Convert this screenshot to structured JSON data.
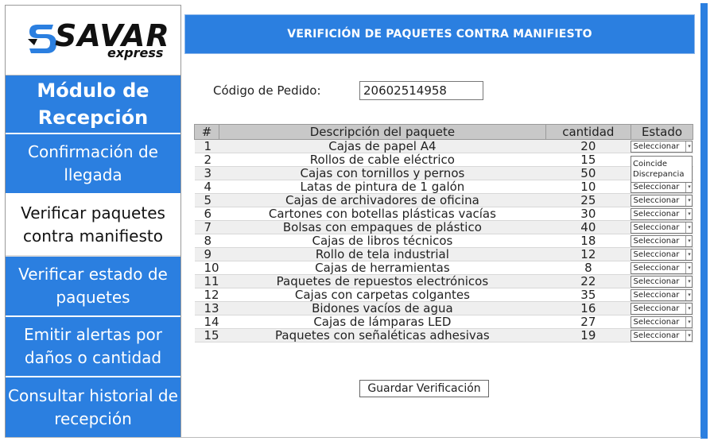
{
  "brand": {
    "name": "SAVAR",
    "tagline": "express",
    "color": "#2b7fe0"
  },
  "sidebar": {
    "title": "Módulo de Recepción",
    "items": [
      {
        "label": "Confirmación de llegada",
        "active": false
      },
      {
        "label": "Verificar paquetes contra manifiesto",
        "active": true
      },
      {
        "label": "Verificar estado de paquetes",
        "active": false
      },
      {
        "label": "Emitir alertas por daños o cantidad",
        "active": false
      },
      {
        "label": "Consultar historial de recepción",
        "active": false
      }
    ]
  },
  "header": {
    "title": "VERIFICIÓN DE PAQUETES CONTRA MANIFIESTO"
  },
  "order": {
    "label": "Código de Pedido:",
    "value": "20602514958"
  },
  "table": {
    "columns": [
      "#",
      "Descripción del paquete",
      "cantidad",
      "Estado"
    ],
    "rows": [
      {
        "num": "1",
        "desc": "Cajas de papel A4",
        "qty": "20",
        "estado": "Seleccionar"
      },
      {
        "num": "2",
        "desc": "Rollos de cable eléctrico",
        "qty": "15",
        "estado": ""
      },
      {
        "num": "3",
        "desc": "Cajas con tornillos y pernos",
        "qty": "50",
        "estado": ""
      },
      {
        "num": "4",
        "desc": "Latas de pintura de 1 galón",
        "qty": "10",
        "estado": "Seleccionar"
      },
      {
        "num": "5",
        "desc": "Cajas de archivadores de oficina",
        "qty": "25",
        "estado": "Seleccionar"
      },
      {
        "num": "6",
        "desc": "Cartones con botellas plásticas vacías",
        "qty": "30",
        "estado": "Seleccionar"
      },
      {
        "num": "7",
        "desc": "Bolsas con empaques de plástico",
        "qty": "40",
        "estado": "Seleccionar"
      },
      {
        "num": "8",
        "desc": "Cajas de libros técnicos",
        "qty": "18",
        "estado": "Seleccionar"
      },
      {
        "num": "9",
        "desc": "Rollo de tela industrial",
        "qty": "12",
        "estado": "Seleccionar"
      },
      {
        "num": "10",
        "desc": "Cajas de herramientas",
        "qty": "8",
        "estado": "Seleccionar"
      },
      {
        "num": "11",
        "desc": "Paquetes de repuestos electrónicos",
        "qty": "22",
        "estado": "Seleccionar"
      },
      {
        "num": "12",
        "desc": "Cajas con carpetas colgantes",
        "qty": "35",
        "estado": "Seleccionar"
      },
      {
        "num": "13",
        "desc": "Bidones vacíos de agua",
        "qty": "16",
        "estado": "Seleccionar"
      },
      {
        "num": "14",
        "desc": "Cajas de lámparas LED",
        "qty": "27",
        "estado": "Seleccionar"
      },
      {
        "num": "15",
        "desc": "Paquetes con señaléticas adhesivas",
        "qty": "19",
        "estado": "Seleccionar"
      }
    ],
    "dropdown_options": [
      "Coincide",
      "Discrepancia"
    ]
  },
  "actions": {
    "save_label": "Guardar Verificación"
  }
}
